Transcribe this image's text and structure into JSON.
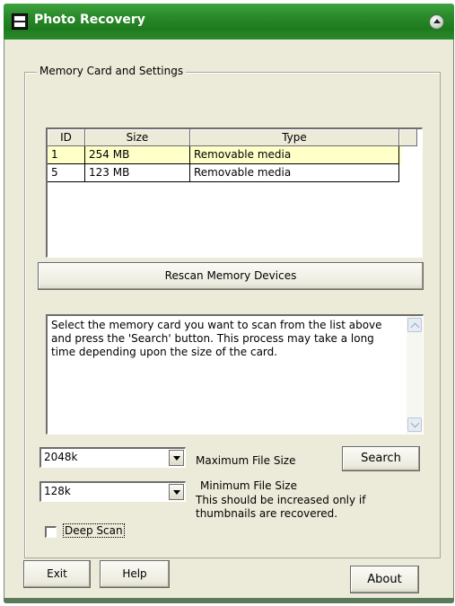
{
  "window": {
    "title": "Photo Recovery"
  },
  "group": {
    "label": "Memory Card and Settings"
  },
  "table": {
    "columns": [
      "ID",
      "Size",
      "Type"
    ],
    "rows": [
      {
        "id": "1",
        "size": "254 MB",
        "type": "Removable media",
        "selected": true
      },
      {
        "id": "5",
        "size": "123 MB",
        "type": "Removable media",
        "selected": false
      }
    ]
  },
  "rescan_button": "Rescan Memory Devices",
  "info_text": "Select the memory card you want to scan from the list above and press the 'Search' button. This process may take a long time depending upon the size of the card.",
  "max_size": {
    "value": "2048k",
    "label": "Maximum File Size"
  },
  "min_size": {
    "value": "128k",
    "label": "Minimum File Size",
    "note_line1": "This should be increased only if",
    "note_line2": "thumbnails are recovered."
  },
  "search_button": "Search",
  "deep_scan": {
    "label": "Deep Scan",
    "checked": false
  },
  "buttons": {
    "exit": "Exit",
    "help": "Help",
    "about": "About"
  },
  "colors": {
    "titlebar": "#2a8a2a",
    "selected_row": "#ffffc8",
    "window_bg": "#ecead8"
  }
}
